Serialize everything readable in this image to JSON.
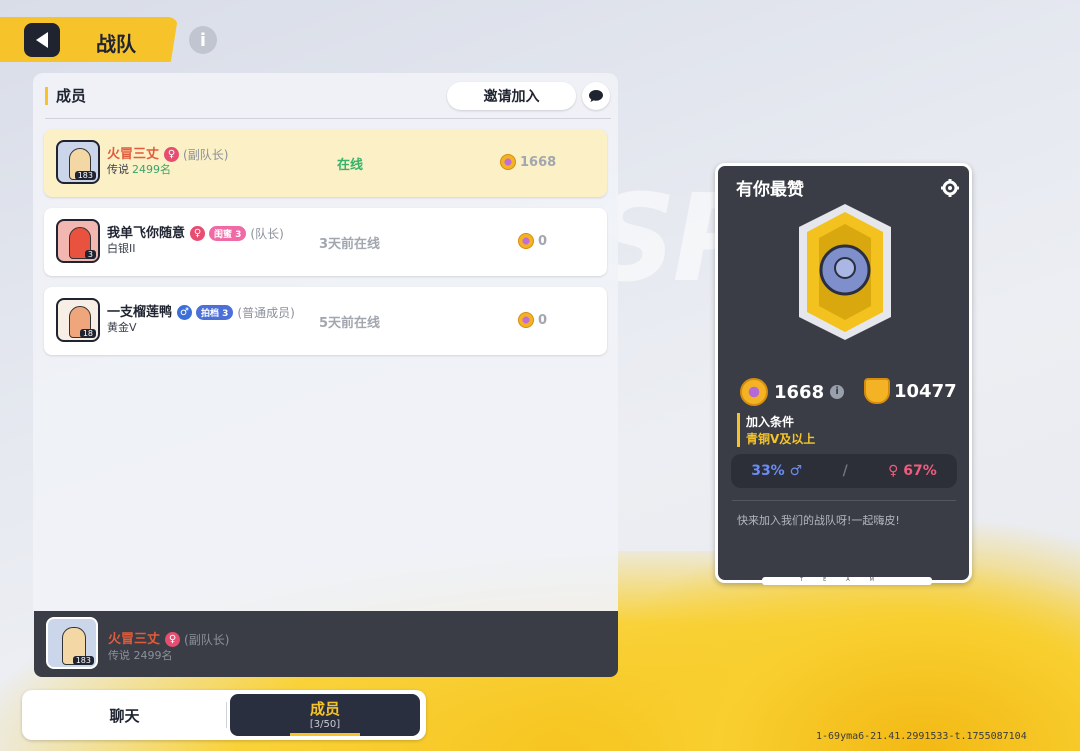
{
  "header": {
    "title": "战队"
  },
  "panel": {
    "section_label": "成员",
    "invite_label": "邀请加入"
  },
  "members": [
    {
      "name": "火冒三丈",
      "rank_prefix": "传说",
      "rank_num": "2499名",
      "badge": "",
      "role": "(副队长)",
      "status": "在线",
      "score": "1668",
      "avatar_level": "183",
      "gender": "♀"
    },
    {
      "name": "我单飞你随意",
      "rank_prefix": "白银II",
      "rank_num": "",
      "badge": "闺蜜 3",
      "role": "(队长)",
      "status": "3天前在线",
      "score": "0",
      "avatar_level": "3",
      "gender": "♀"
    },
    {
      "name": "一支榴莲鸭",
      "rank_prefix": "黄金V",
      "rank_num": "",
      "badge": "拍档 3",
      "role": "(普通成员)",
      "status": "5天前在线",
      "score": "0",
      "avatar_level": "18",
      "gender": "♂"
    }
  ],
  "self": {
    "name": "火冒三丈",
    "rank": "传说 2499名",
    "role": "(副队长)",
    "avatar_level": "183",
    "gender": "♀"
  },
  "tabs": {
    "chat": "聊天",
    "members": "成员",
    "members_count": "[3/50]"
  },
  "card": {
    "title": "有你最赞",
    "score": "1668",
    "trophies": "10477",
    "join_label": "加入条件",
    "join_value": "青铜V及以上",
    "male_pct": "33%",
    "male_symbol": "♂",
    "slash": "/",
    "female_symbol": "♀",
    "female_pct": "67%",
    "description": "快来加入我们的战队呀!一起嗨皮!",
    "footer": "TEAM"
  },
  "watermark": "1-69yma6-21.41.2991533-t.1755087104",
  "colors": {
    "accent": "#f6c42a",
    "dark": "#3a3d45",
    "online": "#37b26a"
  }
}
